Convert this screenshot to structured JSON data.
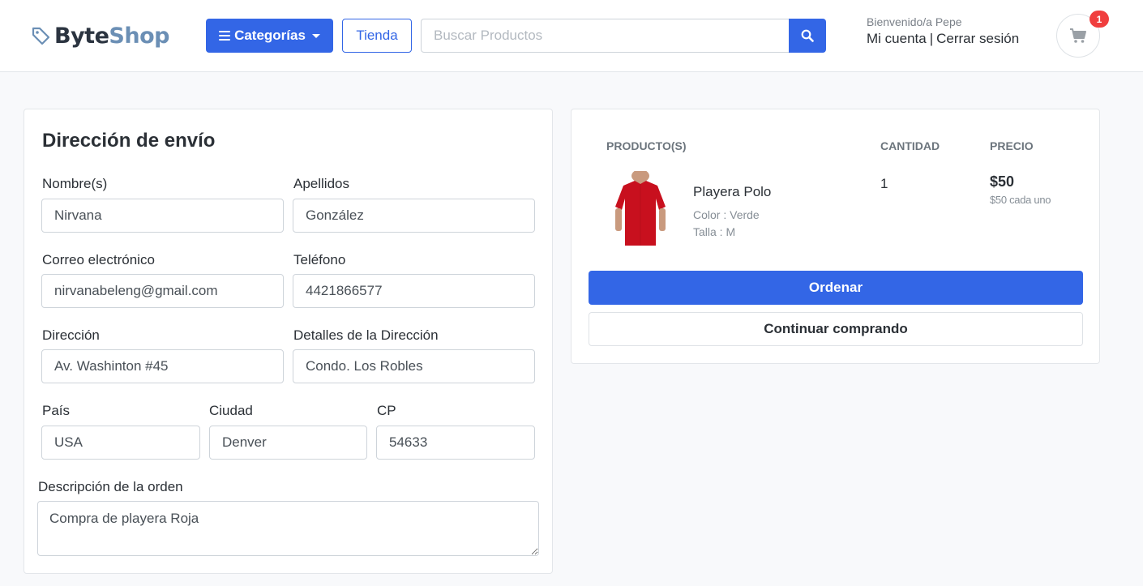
{
  "header": {
    "logo_part1": "Byte",
    "logo_part2": "Shop",
    "categories_label": "Categorías",
    "store_label": "Tienda",
    "search_placeholder": "Buscar Productos",
    "welcome": "Bienvenido/a Pepe",
    "my_account": "Mi cuenta",
    "separator": "|",
    "logout": "Cerrar sesión",
    "cart_count": "1"
  },
  "colors": {
    "primary": "#3366e6",
    "badge": "#f03e3e",
    "logo_dark": "#2b3440",
    "logo_light": "#6b8fb5",
    "shirt": "#c8101e"
  },
  "icons": [
    "tag-icon",
    "bars-icon",
    "caret-down-icon",
    "search-icon",
    "cart-icon"
  ],
  "shipping": {
    "title": "Dirección de envío",
    "first_name": {
      "label": "Nombre(s)",
      "value": "Nirvana"
    },
    "last_name": {
      "label": "Apellidos",
      "value": "González"
    },
    "email": {
      "label": "Correo electrónico",
      "value": "nirvanabeleng@gmail.com"
    },
    "phone": {
      "label": "Teléfono",
      "value": "4421866577"
    },
    "address": {
      "label": "Dirección",
      "value": "Av. Washinton #45"
    },
    "address_details": {
      "label": "Detalles de la Dirección",
      "value": "Condo. Los Robles"
    },
    "country": {
      "label": "País",
      "value": "USA"
    },
    "city": {
      "label": "Ciudad",
      "value": "Denver"
    },
    "zip": {
      "label": "CP",
      "value": "54633"
    },
    "description": {
      "label": "Descripción de la orden",
      "value": "Compra de playera Roja"
    }
  },
  "order": {
    "headers": {
      "product": "PRODUCTO(S)",
      "quantity": "CANTIDAD",
      "price": "PRECIO"
    },
    "items": [
      {
        "name": "Playera Polo",
        "color": "Color : Verde",
        "size": "Talla : M",
        "quantity": "1",
        "price": "$50",
        "unit_price": "$50 cada uno"
      }
    ],
    "order_button": "Ordenar",
    "continue_button": "Continuar comprando"
  }
}
